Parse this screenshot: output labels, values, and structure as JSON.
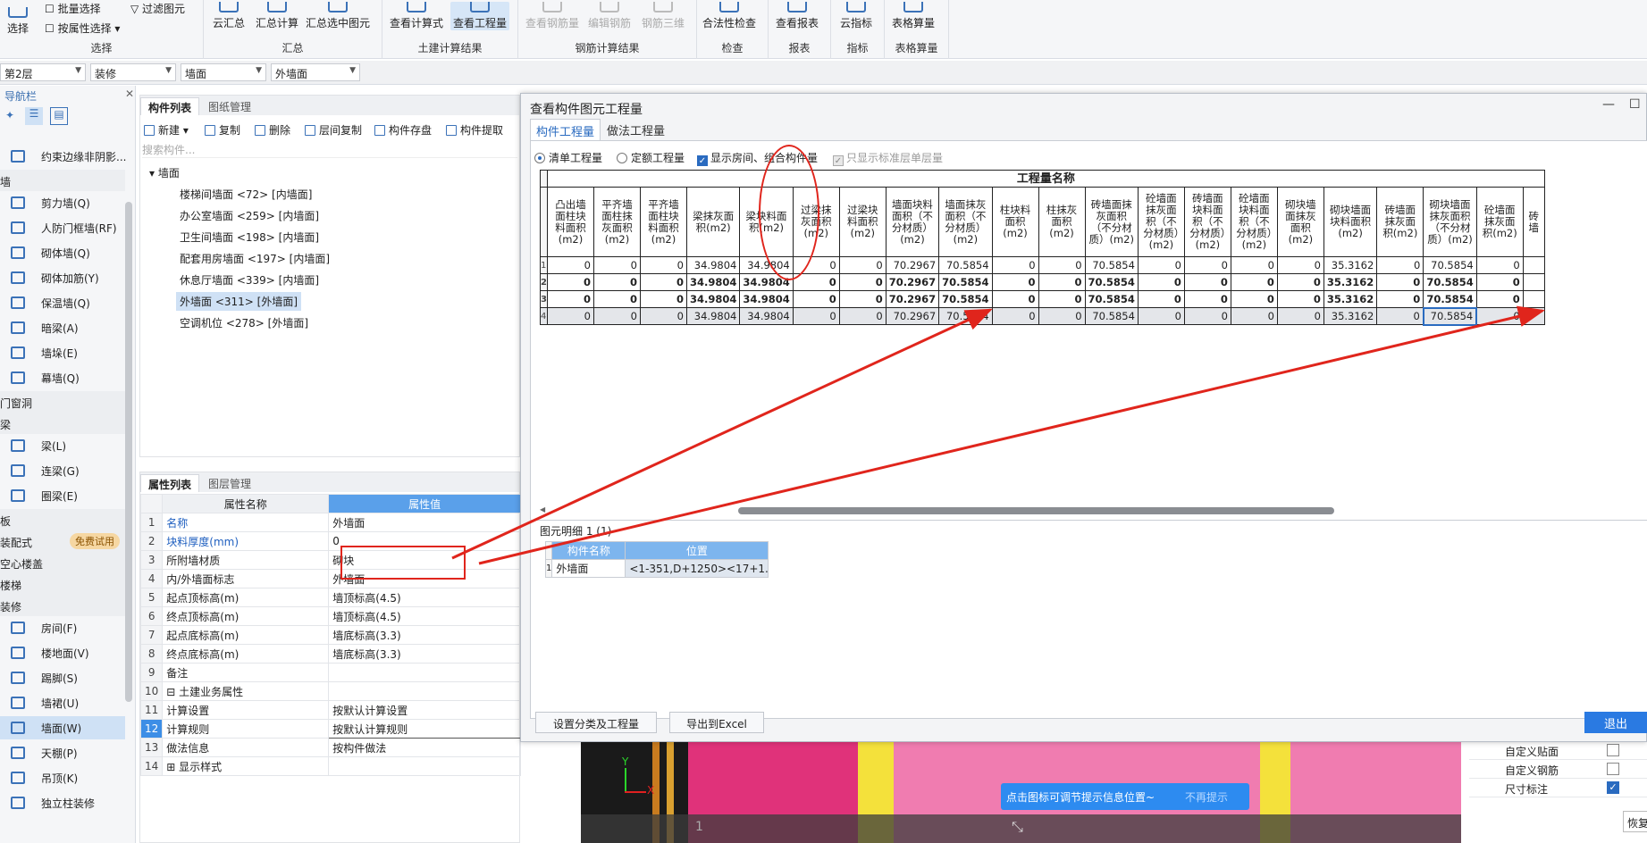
{
  "ribbon": {
    "groups": [
      {
        "name": "选择",
        "buttons": [
          "选择"
        ],
        "small": [
          "批量选择",
          "按属性选择",
          "过滤图元"
        ]
      },
      {
        "name": "汇总",
        "buttons": [
          "云汇总",
          "汇总计算",
          "汇总选中图元"
        ]
      },
      {
        "name": "土建计算结果",
        "buttons": [
          "查看计算式",
          "查看工程量"
        ]
      },
      {
        "name": "钢筋计算结果",
        "buttons": [
          "查看钢筋量",
          "编辑钢筋",
          "钢筋三维"
        ]
      },
      {
        "name": "检查",
        "buttons": [
          "合法性检查"
        ]
      },
      {
        "name": "报表",
        "buttons": [
          "查看报表"
        ]
      },
      {
        "name": "指标",
        "buttons": [
          "云指标"
        ]
      },
      {
        "name": "表格算量",
        "buttons": [
          "表格算量"
        ]
      }
    ]
  },
  "combos": [
    "第2层",
    "装修",
    "墙面",
    "外墙面"
  ],
  "nav": {
    "title": "导航栏",
    "items": [
      {
        "type": "item",
        "label": "约束边缘非阴影..."
      },
      {
        "type": "cat",
        "label": "墙"
      },
      {
        "type": "item",
        "label": "剪力墙(Q)"
      },
      {
        "type": "item",
        "label": "人防门框墙(RF)"
      },
      {
        "type": "item",
        "label": "砌体墙(Q)"
      },
      {
        "type": "item",
        "label": "砌体加筋(Y)"
      },
      {
        "type": "item",
        "label": "保温墙(Q)"
      },
      {
        "type": "item",
        "label": "暗梁(A)"
      },
      {
        "type": "item",
        "label": "墙垛(E)"
      },
      {
        "type": "item",
        "label": "幕墙(Q)"
      },
      {
        "type": "cat",
        "label": "门窗洞"
      },
      {
        "type": "cat",
        "label": "梁"
      },
      {
        "type": "item",
        "label": "梁(L)"
      },
      {
        "type": "item",
        "label": "连梁(G)"
      },
      {
        "type": "item",
        "label": "圈梁(E)"
      },
      {
        "type": "cat",
        "label": "板"
      },
      {
        "type": "cat",
        "label": "装配式",
        "badge": "免费试用"
      },
      {
        "type": "cat",
        "label": "空心楼盖"
      },
      {
        "type": "cat",
        "label": "楼梯"
      },
      {
        "type": "cat",
        "label": "装修"
      },
      {
        "type": "item",
        "label": "房间(F)"
      },
      {
        "type": "item",
        "label": "楼地面(V)"
      },
      {
        "type": "item",
        "label": "踢脚(S)"
      },
      {
        "type": "item",
        "label": "墙裙(U)"
      },
      {
        "type": "item",
        "label": "墙面(W)",
        "selected": true
      },
      {
        "type": "item",
        "label": "天棚(P)"
      },
      {
        "type": "item",
        "label": "吊顶(K)"
      },
      {
        "type": "item",
        "label": "独立柱装修"
      }
    ]
  },
  "component_panel": {
    "tabs": [
      "构件列表",
      "图纸管理"
    ],
    "toolbar": [
      "新建",
      "复制",
      "删除",
      "层间复制",
      "构件存盘",
      "构件提取"
    ],
    "search_placeholder": "搜索构件...",
    "tree_root": "墙面",
    "tree_items": [
      "楼梯间墙面 <72> [内墙面]",
      "办公室墙面 <259> [内墙面]",
      "卫生间墙面 <198> [内墙面]",
      "配套用房墙面 <197> [内墙面]",
      "休息厅墙面 <339> [内墙面]",
      "外墙面 <311> [外墙面]",
      "空调机位 <278> [外墙面]"
    ],
    "selected_index": 5
  },
  "property_panel": {
    "tabs": [
      "属性列表",
      "图层管理"
    ],
    "col_name": "属性名称",
    "col_value": "属性值",
    "rows": [
      {
        "n": "1",
        "name": "名称",
        "value": "外墙面",
        "blue": true
      },
      {
        "n": "2",
        "name": "块料厚度(mm)",
        "value": "0",
        "blue": true
      },
      {
        "n": "3",
        "name": "所附墙材质",
        "value": "砌块"
      },
      {
        "n": "4",
        "name": "内/外墙面标志",
        "value": "外墙面"
      },
      {
        "n": "5",
        "name": "起点顶标高(m)",
        "value": "墙顶标高(4.5)"
      },
      {
        "n": "6",
        "name": "终点顶标高(m)",
        "value": "墙顶标高(4.5)"
      },
      {
        "n": "7",
        "name": "起点底标高(m)",
        "value": "墙底标高(3.3)"
      },
      {
        "n": "8",
        "name": "终点底标高(m)",
        "value": "墙底标高(3.3)"
      },
      {
        "n": "9",
        "name": "备注",
        "value": ""
      },
      {
        "n": "10",
        "name": "⊟ 土建业务属性",
        "value": ""
      },
      {
        "n": "11",
        "name": "计算设置",
        "value": "按默认计算设置"
      },
      {
        "n": "12",
        "name": "计算规则",
        "value": "按默认计算规则",
        "active": true
      },
      {
        "n": "13",
        "name": "做法信息",
        "value": "按构件做法"
      },
      {
        "n": "14",
        "name": "⊞ 显示样式",
        "value": ""
      }
    ]
  },
  "dialog": {
    "title": "查看构件图元工程量",
    "tabs": [
      "构件工程量",
      "做法工程量"
    ],
    "options": {
      "list_qty": "清单工程量",
      "quota_qty": "定额工程量",
      "show_room": "显示房间、组合构件量",
      "std_only": "只显示标准层单层量"
    },
    "table_title": "工程量名称",
    "columns": [
      "凸出墙面柱块料面积(m2)",
      "平齐墙面柱抹灰面积(m2)",
      "平齐墙面柱块料面积(m2)",
      "梁抹灰面积(m2)",
      "梁块料面积(m2)",
      "过梁抹灰面积(m2)",
      "过梁块料面积(m2)",
      "墙面块料面积（不分材质）(m2)",
      "墙面抹灰面积（不分材质）(m2)",
      "柱块料面积(m2)",
      "柱抹灰面积(m2)",
      "砖墙面抹灰面积（不分材质）(m2)",
      "砼墙面抹灰面积（不分材质）(m2)",
      "砖墙面块料面积（不分材质）(m2)",
      "砼墙面块料面积（不分材质）(m2)",
      "砌块墙面抹灰面积(m2)",
      "砌块墙面块料面积(m2)",
      "砖墙面抹灰面积(m2)",
      "砌块墙面抹灰面积（不分材质）(m2)",
      "砼墙面抹灰面积(m2)",
      "砖墙"
    ],
    "rows": [
      {
        "n": "1",
        "bold": false,
        "cells": [
          "0",
          "0",
          "0",
          "34.9804",
          "34.9804",
          "0",
          "0",
          "70.2967",
          "70.5854",
          "0",
          "0",
          "70.5854",
          "0",
          "0",
          "0",
          "0",
          "35.3162",
          "0",
          "70.5854",
          "0",
          ""
        ]
      },
      {
        "n": "2",
        "bold": true,
        "cells": [
          "0",
          "0",
          "0",
          "34.9804",
          "34.9804",
          "0",
          "0",
          "70.2967",
          "70.5854",
          "0",
          "0",
          "70.5854",
          "0",
          "0",
          "0",
          "0",
          "35.3162",
          "0",
          "70.5854",
          "0",
          ""
        ]
      },
      {
        "n": "3",
        "bold": true,
        "cells": [
          "0",
          "0",
          "0",
          "34.9804",
          "34.9804",
          "0",
          "0",
          "70.2967",
          "70.5854",
          "0",
          "0",
          "70.5854",
          "0",
          "0",
          "0",
          "0",
          "35.3162",
          "0",
          "70.5854",
          "0",
          ""
        ]
      },
      {
        "n": "4",
        "bold": false,
        "selected": true,
        "cells": [
          "0",
          "0",
          "0",
          "34.9804",
          "34.9804",
          "0",
          "0",
          "70.2967",
          "70.5854",
          "0",
          "0",
          "70.5854",
          "0",
          "0",
          "0",
          "0",
          "35.3162",
          "0",
          "70.5854",
          "0",
          ""
        ]
      }
    ],
    "detail_label": "图元明细  1 (1)",
    "detail_cols": [
      "构件名称",
      "位置"
    ],
    "detail_row": {
      "n": "1",
      "name": "外墙面",
      "pos": "<1-351,D+1250><17+1..."
    },
    "btn_settings": "设置分类及工程量",
    "btn_export": "导出到Excel",
    "btn_exit": "退出"
  },
  "canvas": {
    "tip": "点击图标可调节提示信息位置~",
    "no_more": "不再提示",
    "axis_y": "Y",
    "axis_x": "X",
    "floor_num": "1"
  },
  "right_panel": {
    "rows": [
      {
        "label": "自定义贴面",
        "checked": false
      },
      {
        "label": "自定义钢筋",
        "checked": false
      },
      {
        "label": "尺寸标注",
        "checked": true
      }
    ],
    "restore": "恢复"
  }
}
